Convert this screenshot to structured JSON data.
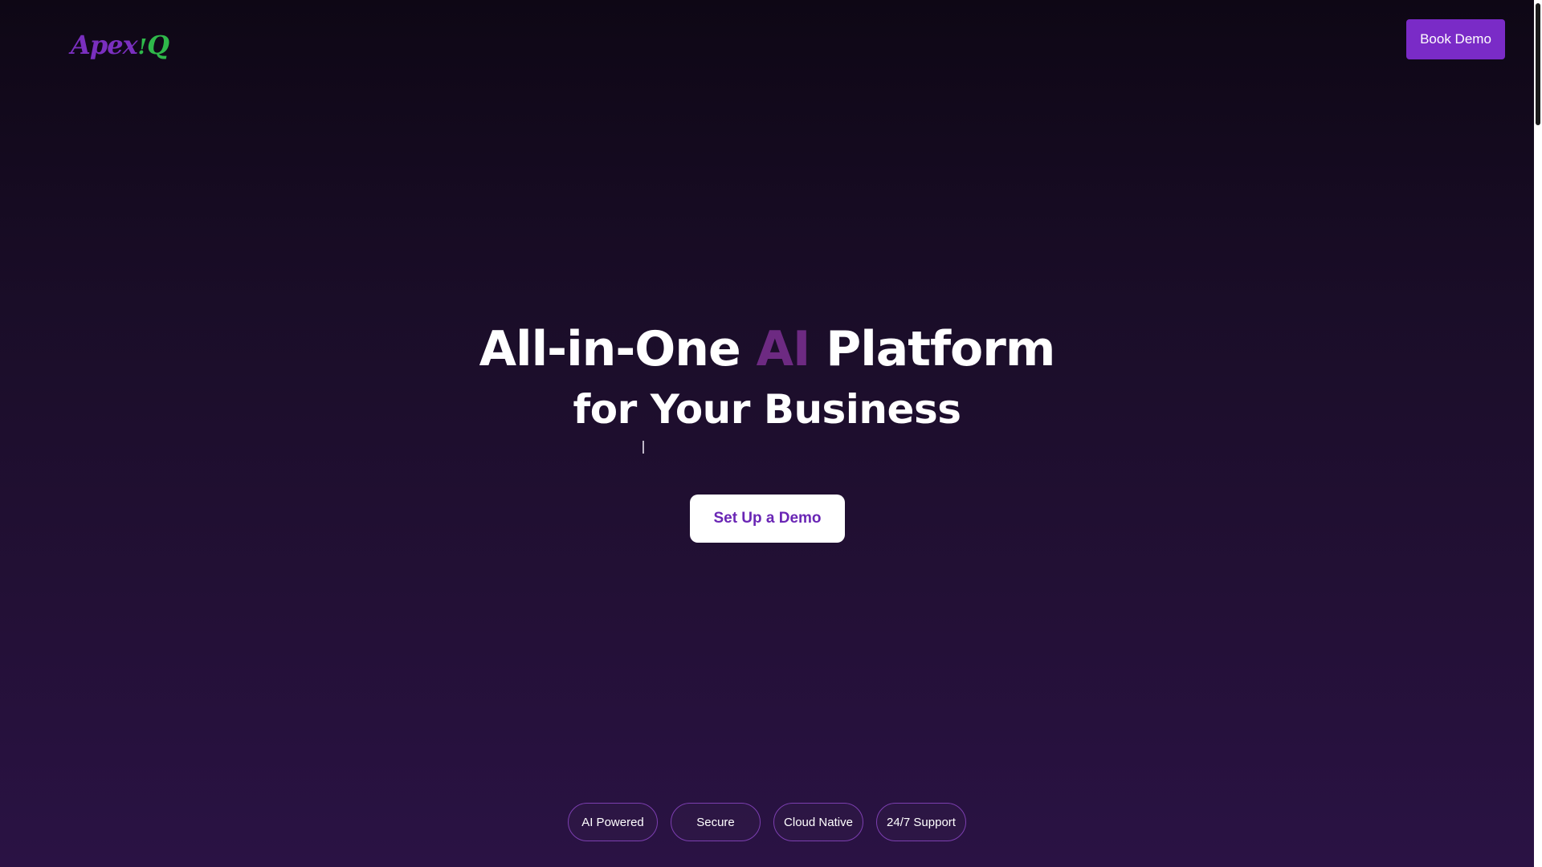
{
  "header": {
    "logo": {
      "part1": "Apex",
      "part2": "!",
      "part3": "Q"
    },
    "book_demo_label": "Book Demo"
  },
  "hero": {
    "title_pre": "All-in-One ",
    "title_accent": "AI",
    "title_post": " Platform",
    "subtitle": "for Your Business",
    "cta_label": "Set Up a Demo"
  },
  "features": [
    {
      "label": "AI Powered"
    },
    {
      "label": "Secure"
    },
    {
      "label": "Cloud Native"
    },
    {
      "label": "24/7 Support"
    }
  ],
  "colors": {
    "brand_purple": "#7a2bc7",
    "logo_purple": "#7a2fbf",
    "logo_green": "#2fb84a",
    "accent_text": "#6d2a82",
    "background_top": "#0e0715",
    "background_bottom": "#2a1244"
  }
}
